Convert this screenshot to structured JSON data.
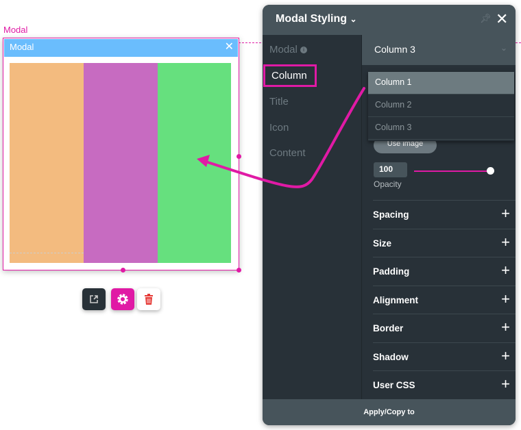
{
  "canvas": {
    "selection_label": "Modal",
    "modal_title": "Modal",
    "column_colors": [
      "#f3bb7f",
      "#c76bc1",
      "#66e07e"
    ],
    "accent": "#e01aa5"
  },
  "toolbar": {
    "open_icon": "external-link-icon",
    "settings_icon": "gear-icon",
    "delete_icon": "trash-icon"
  },
  "panel": {
    "title": "Modal Styling",
    "nav": [
      {
        "label": "Modal"
      },
      {
        "label": "Column"
      },
      {
        "label": "Title"
      },
      {
        "label": "Icon"
      },
      {
        "label": "Content"
      }
    ],
    "selected_nav": "Column",
    "column_select": {
      "value": "Column 3",
      "options": [
        "Column 1",
        "Column 2",
        "Column 3"
      ],
      "highlighted": "Column 1"
    },
    "use_image_label": "Use image",
    "opacity": {
      "value": "100",
      "label": "Opacity",
      "level": 100
    },
    "sections": [
      "Spacing",
      "Size",
      "Padding",
      "Alignment",
      "Border",
      "Shadow",
      "User CSS"
    ],
    "footer_label": "Apply/Copy to"
  }
}
